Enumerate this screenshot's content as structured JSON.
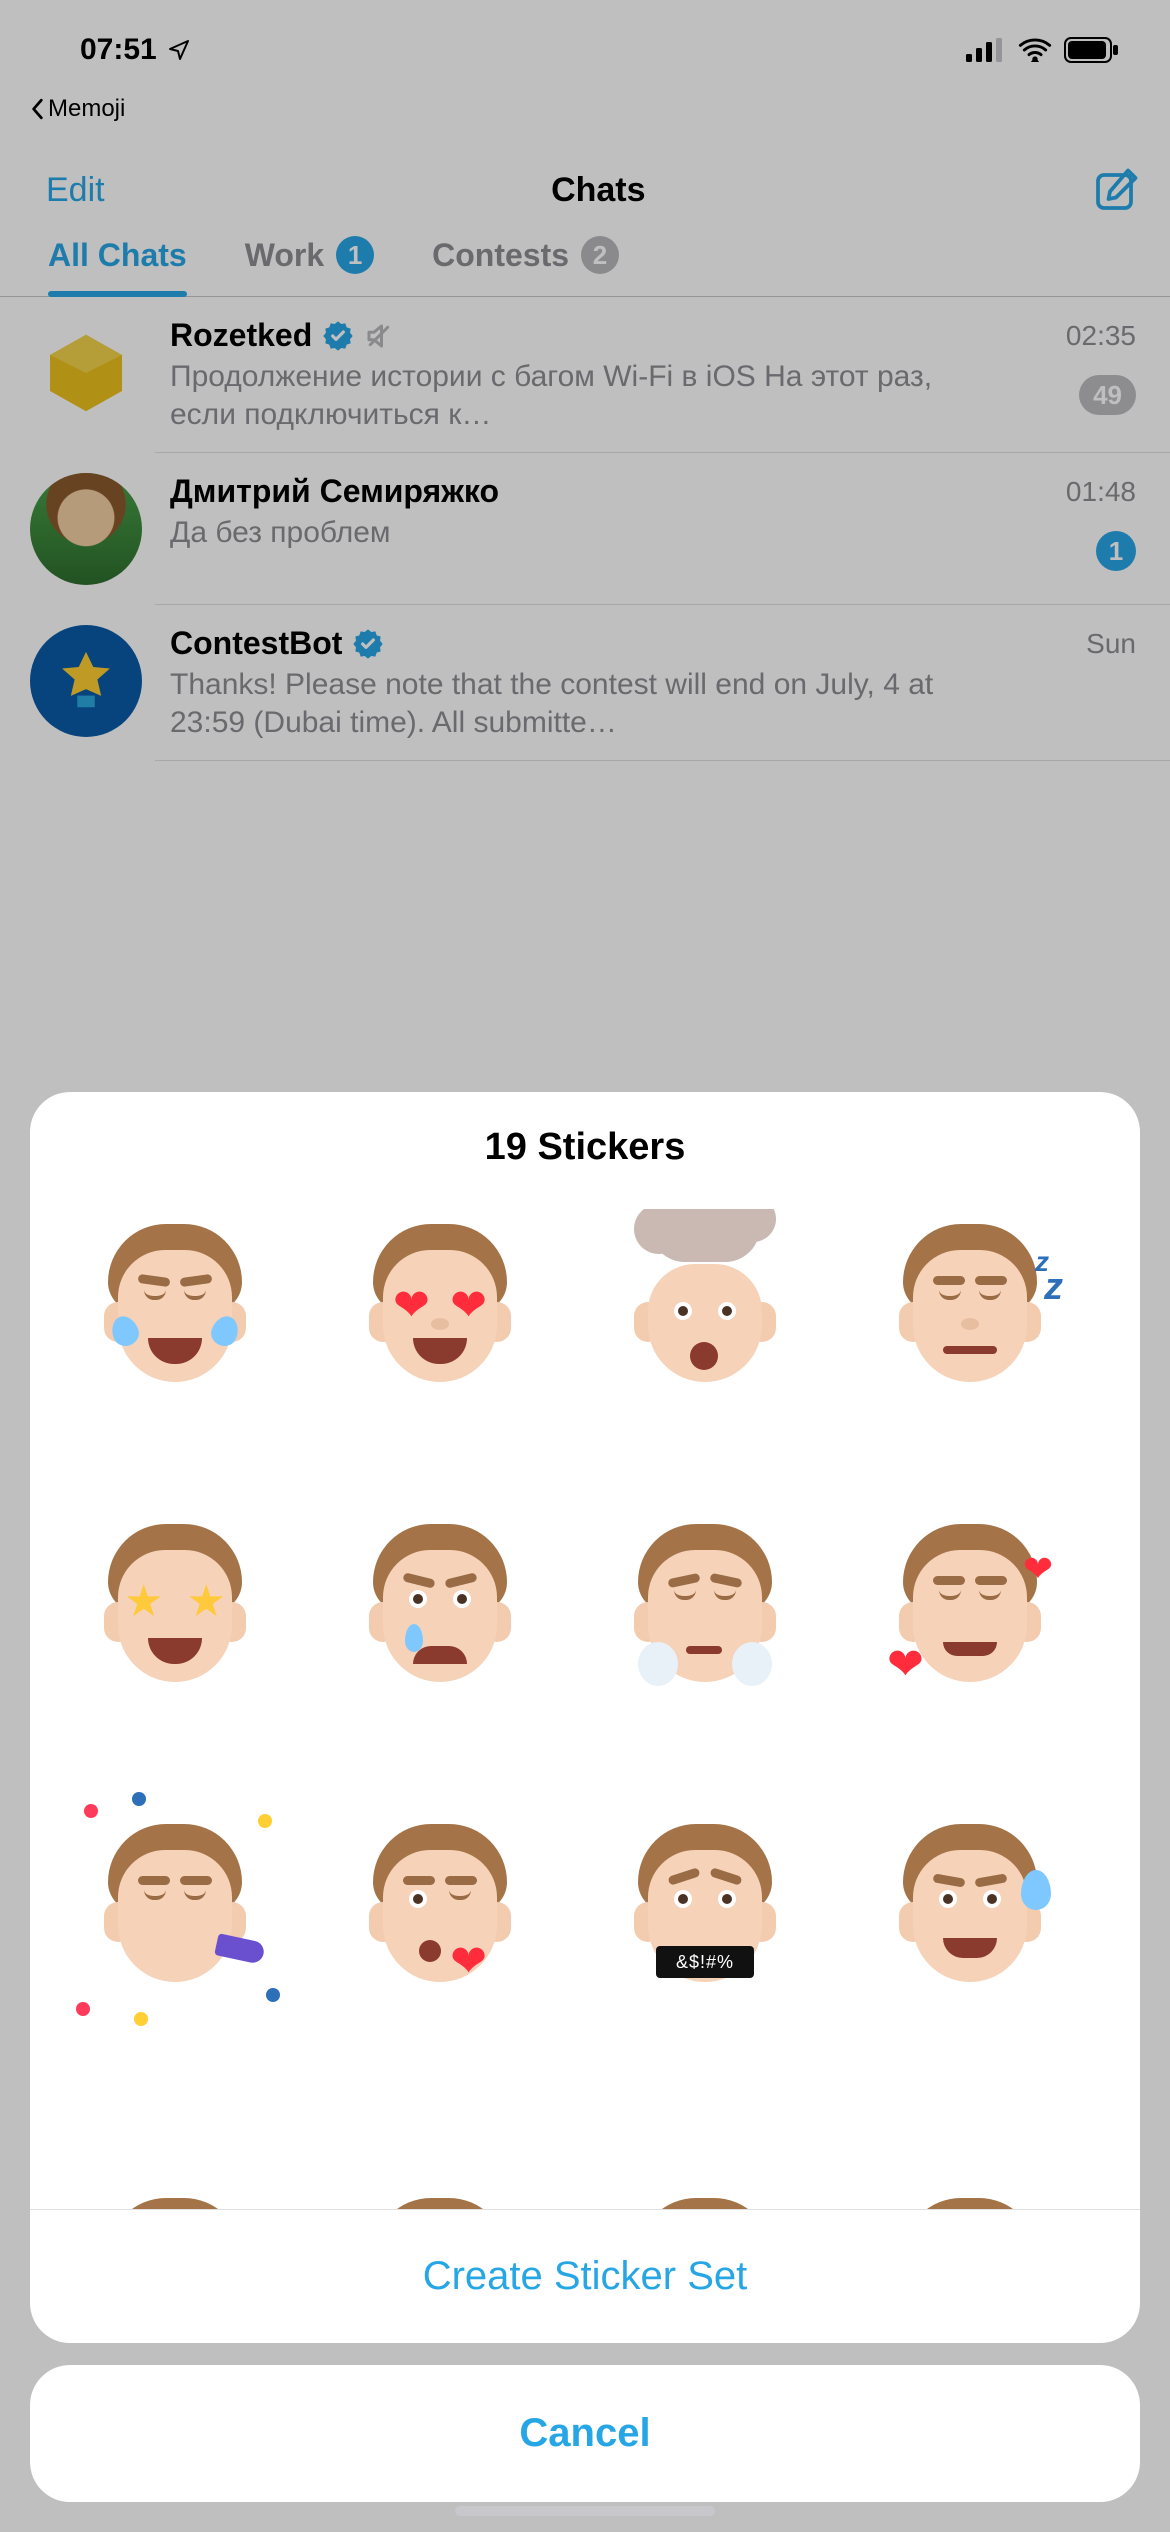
{
  "status": {
    "time": "07:51",
    "back_app": "Memoji"
  },
  "nav": {
    "edit": "Edit",
    "title": "Chats"
  },
  "tabs": {
    "all": "All Chats",
    "work": {
      "label": "Work",
      "count": "1"
    },
    "contests": {
      "label": "Contests",
      "count": "2"
    }
  },
  "chats": [
    {
      "name": "Rozetked",
      "verified": true,
      "muted": true,
      "msg": "Продолжение истории с багом Wi-Fi в iOS На этот раз, если подключиться к…",
      "time": "02:35",
      "unread": "49",
      "unread_style": "gray"
    },
    {
      "name": "Дмитрий Семиряжко",
      "verified": false,
      "muted": false,
      "msg": "Да без проблем",
      "time": "01:48",
      "unread": "1",
      "unread_style": "blue"
    },
    {
      "name": "ContestBot",
      "verified": true,
      "muted": false,
      "msg": "Thanks! Please note that the contest will end on July, 4 at 23:59 (Dubai time). All submitte…",
      "time": "Sun",
      "unread": "",
      "unread_style": ""
    }
  ],
  "sheet": {
    "title": "19 Stickers",
    "create": "Create Sticker Set",
    "cancel": "Cancel",
    "swear": "&$!#%",
    "stickers": [
      "laugh-tears",
      "heart-eyes",
      "mind-blown",
      "sleeping",
      "star-struck",
      "crying",
      "steam-nose",
      "loved",
      "party",
      "blow-kiss",
      "swearing",
      "nervous-sweat",
      "partial-1",
      "partial-2",
      "partial-3",
      "partial-4"
    ]
  }
}
